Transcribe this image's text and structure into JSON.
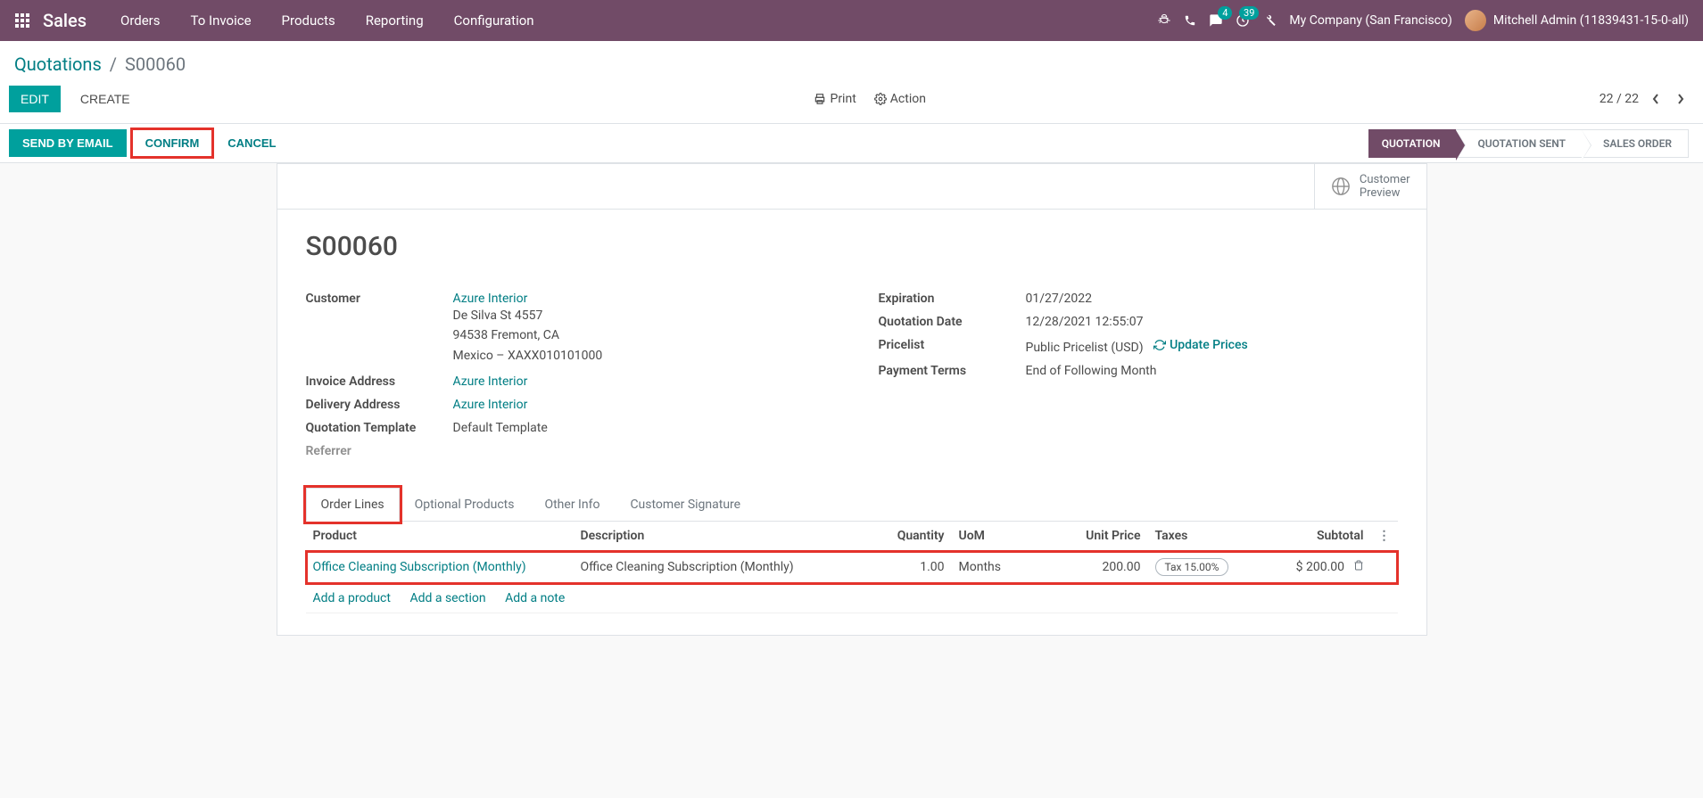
{
  "navbar": {
    "brand": "Sales",
    "menu": [
      "Orders",
      "To Invoice",
      "Products",
      "Reporting",
      "Configuration"
    ],
    "messages_badge": "4",
    "activities_badge": "39",
    "company": "My Company (San Francisco)",
    "user": "Mitchell Admin (11839431-15-0-all)"
  },
  "breadcrumb": {
    "parent": "Quotations",
    "current": "S00060"
  },
  "controlbar": {
    "edit": "EDIT",
    "create": "CREATE",
    "print": "Print",
    "action": "Action",
    "pager": "22 / 22"
  },
  "statusbar": {
    "send_email": "SEND BY EMAIL",
    "confirm": "CONFIRM",
    "cancel": "CANCEL",
    "steps": [
      "QUOTATION",
      "QUOTATION SENT",
      "SALES ORDER"
    ],
    "active_step": 0
  },
  "sheet": {
    "customer_preview": "Customer\nPreview",
    "title": "S00060",
    "left": {
      "customer_label": "Customer",
      "customer_name": "Azure Interior",
      "addr1": "De Silva St 4557",
      "addr2": "94538 Fremont, CA",
      "addr3": "Mexico – XAXX010101000",
      "invoice_address_label": "Invoice Address",
      "invoice_address": "Azure Interior",
      "delivery_address_label": "Delivery Address",
      "delivery_address": "Azure Interior",
      "quotation_template_label": "Quotation Template",
      "quotation_template": "Default Template",
      "referrer_label": "Referrer"
    },
    "right": {
      "expiration_label": "Expiration",
      "expiration": "01/27/2022",
      "quotation_date_label": "Quotation Date",
      "quotation_date": "12/28/2021 12:55:07",
      "pricelist_label": "Pricelist",
      "pricelist": "Public Pricelist (USD)",
      "update_prices": "Update Prices",
      "payment_terms_label": "Payment Terms",
      "payment_terms": "End of Following Month"
    }
  },
  "tabs": [
    "Order Lines",
    "Optional Products",
    "Other Info",
    "Customer Signature"
  ],
  "lines": {
    "headers": {
      "product": "Product",
      "description": "Description",
      "quantity": "Quantity",
      "uom": "UoM",
      "unit_price": "Unit Price",
      "taxes": "Taxes",
      "subtotal": "Subtotal"
    },
    "row": {
      "product": "Office Cleaning Subscription (Monthly)",
      "description": "Office Cleaning Subscription (Monthly)",
      "quantity": "1.00",
      "uom": "Months",
      "unit_price": "200.00",
      "tax": "Tax 15.00%",
      "subtotal": "$ 200.00"
    },
    "add_product": "Add a product",
    "add_section": "Add a section",
    "add_note": "Add a note"
  }
}
